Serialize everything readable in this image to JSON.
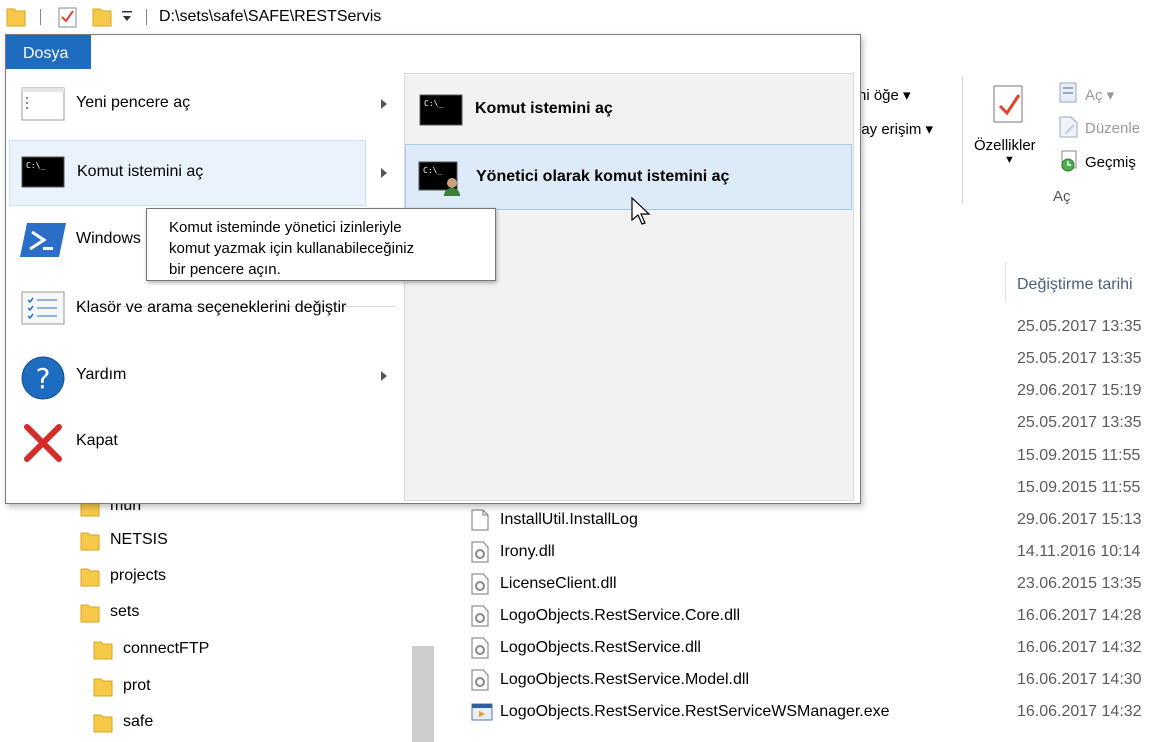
{
  "titlebar": {
    "path": "D:\\sets\\safe\\SAFE\\RESTServis"
  },
  "ribbon": {
    "partial_new_item": "ni öğe",
    "partial_easy_access": "lay erişim",
    "properties": "Özellikler",
    "open": "Aç",
    "edit": "Düzenle",
    "history": "Geçmiş",
    "group_open": "Aç"
  },
  "file_menu": {
    "tab": "Dosya",
    "items": [
      {
        "label": "Yeni pencere aç",
        "icon": "new-window-icon"
      },
      {
        "label": "Komut istemini aç",
        "icon": "command-prompt-icon"
      },
      {
        "label": "Windows",
        "icon": "powershell-icon"
      },
      {
        "label": "Klasör ve arama seçeneklerini değiştir",
        "icon": "folder-options-icon"
      },
      {
        "label": "Yardım",
        "icon": "help-icon"
      },
      {
        "label": "Kapat",
        "icon": "close-icon"
      }
    ],
    "submenu": [
      {
        "label": "Komut istemini aç",
        "icon": "command-prompt-icon"
      },
      {
        "label": "Yönetici olarak komut istemini aç",
        "icon": "admin-command-prompt-icon"
      }
    ],
    "tooltip": {
      "line1": "Komut isteminde yönetici izinleriyle",
      "line2": "komut yazmak için kullanabileceğiniz",
      "line3": "bir pencere açın."
    }
  },
  "file_list": {
    "column_date": "Değiştirme tarihi",
    "hidden_dates": [
      "25.05.2017 13:35",
      "25.05.2017 13:35",
      "29.06.2017 15:19",
      "25.05.2017 13:35",
      "15.09.2015 11:55",
      "15.09.2015 11:55"
    ],
    "rows": [
      {
        "name": "InstallUtil.InstallLog",
        "date": "29.06.2017 15:13",
        "icon": "text-file-icon"
      },
      {
        "name": "Irony.dll",
        "date": "14.11.2016 10:14",
        "icon": "dll-file-icon"
      },
      {
        "name": "LicenseClient.dll",
        "date": "23.06.2015 13:35",
        "icon": "dll-file-icon"
      },
      {
        "name": "LogoObjects.RestService.Core.dll",
        "date": "16.06.2017 14:28",
        "icon": "dll-file-icon"
      },
      {
        "name": "LogoObjects.RestService.dll",
        "date": "16.06.2017 14:32",
        "icon": "dll-file-icon"
      },
      {
        "name": "LogoObjects.RestService.Model.dll",
        "date": "16.06.2017 14:30",
        "icon": "dll-file-icon"
      },
      {
        "name": "LogoObjects.RestService.RestServiceWSManager.exe",
        "date": "16.06.2017 14:32",
        "icon": "exe-file-icon"
      }
    ]
  },
  "nav_tree": {
    "items": [
      {
        "label": "mun"
      },
      {
        "label": "NETSIS"
      },
      {
        "label": "projects"
      },
      {
        "label": "sets"
      },
      {
        "label": "connectFTP"
      },
      {
        "label": "prot"
      },
      {
        "label": "safe"
      }
    ]
  },
  "colors": {
    "accent": "#1e6cc0",
    "hover": "#ddebf8",
    "folder": "#f7c948"
  }
}
